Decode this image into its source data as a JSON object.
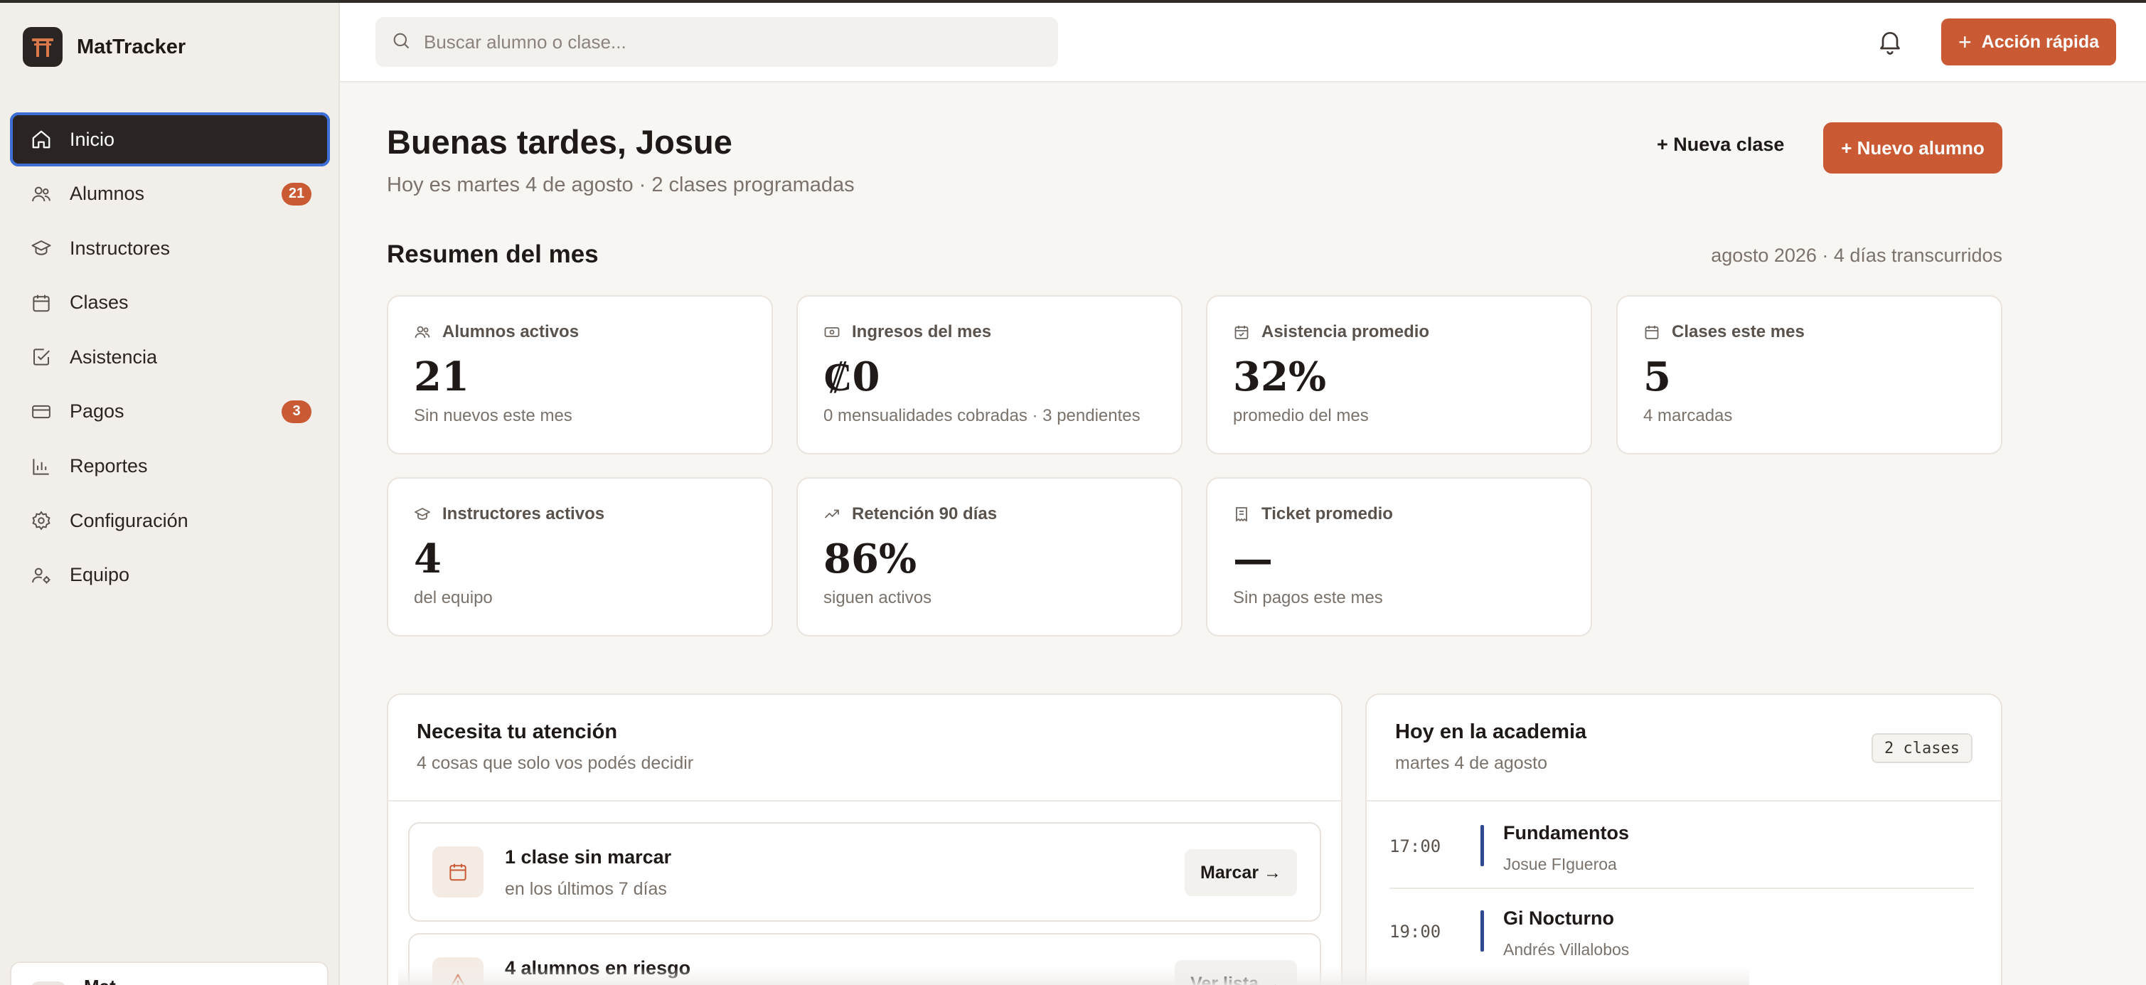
{
  "app": {
    "name": "MatTracker"
  },
  "sidebar": {
    "items": [
      {
        "label": "Inicio",
        "icon": "home-icon",
        "active": true
      },
      {
        "label": "Alumnos",
        "icon": "users-icon",
        "badge": "21"
      },
      {
        "label": "Instructores",
        "icon": "graduation-cap-icon"
      },
      {
        "label": "Clases",
        "icon": "calendar-icon"
      },
      {
        "label": "Asistencia",
        "icon": "check-square-icon"
      },
      {
        "label": "Pagos",
        "icon": "credit-card-icon",
        "badge": "3"
      },
      {
        "label": "Reportes",
        "icon": "bar-chart-icon"
      },
      {
        "label": "Configuración",
        "icon": "gear-icon"
      },
      {
        "label": "Equipo",
        "icon": "user-cog-icon"
      }
    ],
    "user_name": "Mat..."
  },
  "header": {
    "search_placeholder": "Buscar alumno o clase...",
    "quick_action": "Acción rápida"
  },
  "main": {
    "greeting": "Buenas tardes, Josue",
    "subtitle": "Hoy es martes 4 de agosto · 2 clases programadas",
    "new_class": "+ Nueva clase",
    "new_student": "+ Nuevo alumno",
    "summary_title": "Resumen del mes",
    "summary_meta": "agosto 2026 · 4 días transcurridos",
    "cards": [
      {
        "label": "Alumnos activos",
        "value": "21",
        "sub": "Sin nuevos este mes",
        "icon": "users-icon"
      },
      {
        "label": "Ingresos del mes",
        "value": "₡0",
        "sub": "0 mensualidades cobradas · 3 pendientes",
        "icon": "banknote-icon"
      },
      {
        "label": "Asistencia promedio",
        "value": "32%",
        "sub": "promedio del mes",
        "icon": "calendar-check-icon"
      },
      {
        "label": "Clases este mes",
        "value": "5",
        "sub": "4 marcadas",
        "icon": "calendar-icon"
      },
      {
        "label": "Instructores activos",
        "value": "4",
        "sub": "del equipo",
        "icon": "graduation-cap-icon"
      },
      {
        "label": "Retención 90 días",
        "value": "86%",
        "sub": "siguen activos",
        "icon": "trending-up-icon"
      },
      {
        "label": "Ticket promedio",
        "value": "—",
        "sub": "Sin pagos este mes",
        "icon": "receipt-icon"
      }
    ],
    "attention": {
      "title": "Necesita tu atención",
      "subtitle": "4 cosas que solo vos podés decidir",
      "items": [
        {
          "title": "1 clase sin marcar",
          "sub": "en los últimos 7 días",
          "action": "Marcar →",
          "icon": "calendar-icon"
        },
        {
          "title": "4 alumnos en riesgo",
          "sub": "",
          "action": "Ver lista →",
          "icon": "alert-triangle-icon"
        }
      ]
    },
    "today": {
      "title": "Hoy en la academia",
      "subtitle": "martes 4 de agosto",
      "pill": "2 clases",
      "classes": [
        {
          "time": "17:00",
          "name": "Fundamentos",
          "instructor": "Josue FIgueroa"
        },
        {
          "time": "19:00",
          "name": "Gi Nocturno",
          "instructor": "Andrés Villalobos"
        }
      ]
    }
  },
  "colors": {
    "accent": "#c95a33",
    "sidebar_active": "#2a2522",
    "focus_ring": "#3d6fd6",
    "class_bar": "#2f4a8f"
  }
}
